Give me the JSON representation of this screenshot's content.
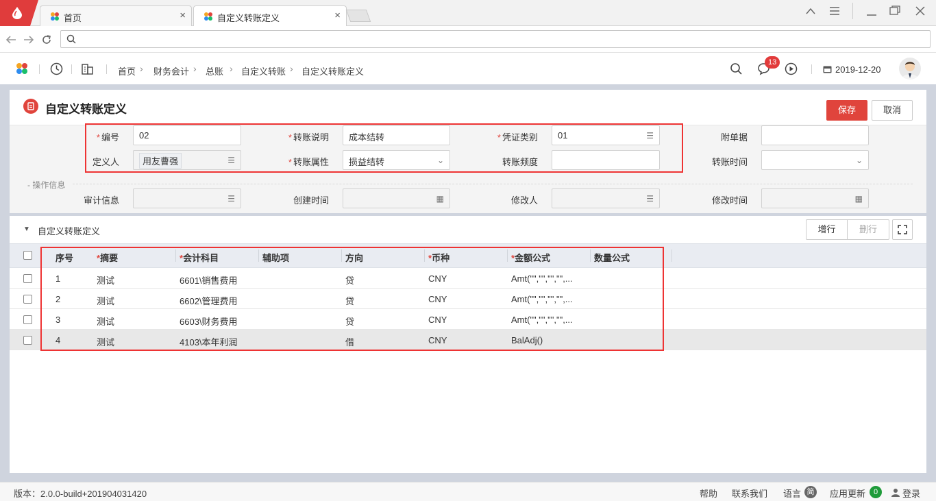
{
  "browser": {
    "tabs": [
      {
        "title": "首页"
      },
      {
        "title": "自定义转账定义"
      }
    ]
  },
  "header": {
    "breadcrumb": [
      "首页",
      "财务会计",
      "总账",
      "自定义转账",
      "自定义转账定义"
    ],
    "notification_count": "13",
    "date": "2019-12-20"
  },
  "page": {
    "title": "自定义转账定义",
    "save_label": "保存",
    "cancel_label": "取消"
  },
  "form": {
    "code_label": "编号",
    "code_value": "02",
    "desc_label": "转账说明",
    "desc_value": "成本结转",
    "voucher_type_label": "凭证类别",
    "voucher_type_value": "01",
    "attachments_label": "附单据",
    "attachments_value": "",
    "definer_label": "定义人",
    "definer_value": "用友曹强",
    "attr_label": "转账属性",
    "attr_value": "损益结转",
    "freq_label": "转账频度",
    "freq_value": "",
    "time_label": "转账时间",
    "time_value": ""
  },
  "ops": {
    "section_label": "- 操作信息",
    "audit_label": "审计信息",
    "created_label": "创建时间",
    "modifier_label": "修改人",
    "modified_label": "修改时间"
  },
  "grid": {
    "title": "自定义转账定义",
    "add_label": "增行",
    "delete_label": "删行",
    "columns": [
      "序号",
      "摘要",
      "会计科目",
      "辅助项",
      "方向",
      "币种",
      "金额公式",
      "数量公式"
    ],
    "rows": [
      {
        "no": "1",
        "summary": "测试",
        "account": "6601\\销售费用",
        "aux": "",
        "direction": "贷",
        "currency": "CNY",
        "amount_formula": "Amt(\"\",\"\",\"\",\"\",...",
        "qty_formula": ""
      },
      {
        "no": "2",
        "summary": "测试",
        "account": "6602\\管理费用",
        "aux": "",
        "direction": "贷",
        "currency": "CNY",
        "amount_formula": "Amt(\"\",\"\",\"\",\"\",...",
        "qty_formula": ""
      },
      {
        "no": "3",
        "summary": "测试",
        "account": "6603\\财务费用",
        "aux": "",
        "direction": "贷",
        "currency": "CNY",
        "amount_formula": "Amt(\"\",\"\",\"\",\"\",...",
        "qty_formula": ""
      },
      {
        "no": "4",
        "summary": "测试",
        "account": "4103\\本年利润",
        "aux": "",
        "direction": "借",
        "currency": "CNY",
        "amount_formula": "BalAdj()",
        "qty_formula": ""
      }
    ]
  },
  "footer": {
    "version": "版本：2.0.0-build+201904031420",
    "help": "帮助",
    "contact": "联系我们",
    "language": "语言",
    "language_badge": "简",
    "updates": "应用更新",
    "updates_count": "0",
    "login": "登录"
  },
  "colors": {
    "accent": "#e0443c",
    "badge_green": "#1f9b3a"
  }
}
